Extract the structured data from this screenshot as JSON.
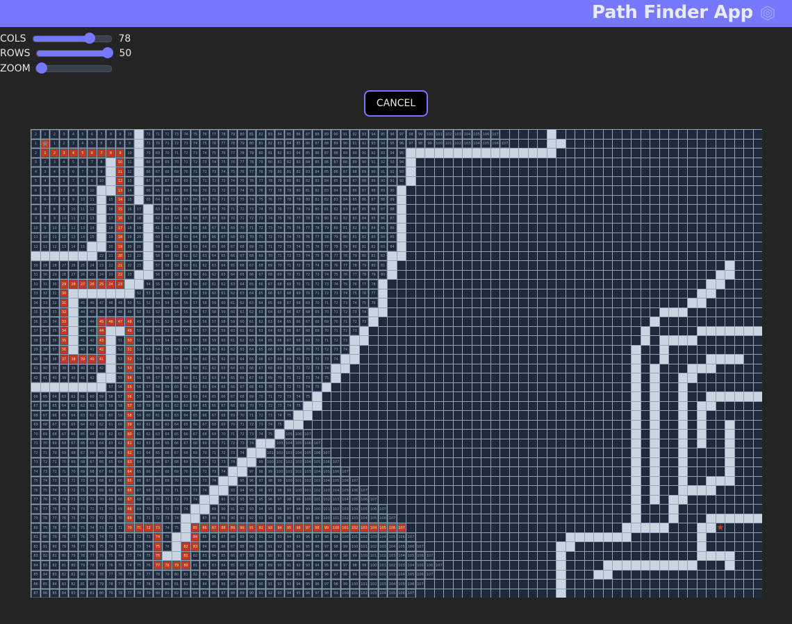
{
  "header": {
    "title": "Path Finder App",
    "logo_icon": "hexagon-target-icon"
  },
  "controls": [
    {
      "label": "COLS",
      "value": "78",
      "fraction": 0.72
    },
    {
      "label": "ROWS",
      "value": "50",
      "fraction": 1.0
    },
    {
      "label": "ZOOM",
      "value": "",
      "fraction": 0.0
    }
  ],
  "cancel_label": "CANCEL",
  "grid": {
    "cols": 78,
    "rows": 50,
    "start": [
      1,
      1
    ],
    "goal": [
      42,
      73
    ],
    "start_icon": "star-icon",
    "goal_icon": "star-icon",
    "max_distance_shown": 107,
    "colors": {
      "cell": "#1e293b",
      "wall": "#cbd5e1",
      "path": "#c0391f",
      "start_star": "#7b8594",
      "goal_star": "#c0391f"
    },
    "walls": [
      [
        0,
        11
      ],
      [
        0,
        55
      ],
      [
        1,
        11
      ],
      [
        1,
        55
      ],
      [
        1,
        56
      ],
      [
        2,
        11
      ],
      [
        2,
        40
      ],
      [
        2,
        41
      ],
      [
        2,
        42
      ],
      [
        2,
        43
      ],
      [
        2,
        44
      ],
      [
        2,
        45
      ],
      [
        2,
        46
      ],
      [
        2,
        47
      ],
      [
        2,
        48
      ],
      [
        2,
        49
      ],
      [
        2,
        50
      ],
      [
        2,
        51
      ],
      [
        2,
        52
      ],
      [
        2,
        53
      ],
      [
        2,
        54
      ],
      [
        2,
        55
      ],
      [
        3,
        8
      ],
      [
        3,
        11
      ],
      [
        3,
        40
      ],
      [
        4,
        8
      ],
      [
        4,
        11
      ],
      [
        4,
        40
      ],
      [
        5,
        8
      ],
      [
        5,
        11
      ],
      [
        5,
        40
      ],
      [
        6,
        7
      ],
      [
        6,
        8
      ],
      [
        6,
        11
      ],
      [
        6,
        39
      ],
      [
        7,
        7
      ],
      [
        7,
        11
      ],
      [
        7,
        39
      ],
      [
        8,
        7
      ],
      [
        8,
        12
      ],
      [
        8,
        39
      ],
      [
        9,
        7
      ],
      [
        9,
        12
      ],
      [
        9,
        39
      ],
      [
        10,
        7
      ],
      [
        10,
        12
      ],
      [
        10,
        39
      ],
      [
        11,
        7
      ],
      [
        11,
        12
      ],
      [
        11,
        39
      ],
      [
        12,
        6
      ],
      [
        12,
        7
      ],
      [
        12,
        12
      ],
      [
        12,
        39
      ],
      [
        13,
        0
      ],
      [
        13,
        1
      ],
      [
        13,
        2
      ],
      [
        13,
        3
      ],
      [
        13,
        4
      ],
      [
        13,
        5
      ],
      [
        13,
        6
      ],
      [
        13,
        12
      ],
      [
        13,
        38
      ],
      [
        13,
        39
      ],
      [
        14,
        12
      ],
      [
        14,
        38
      ],
      [
        14,
        74
      ],
      [
        15,
        11
      ],
      [
        15,
        12
      ],
      [
        15,
        38
      ],
      [
        15,
        73
      ],
      [
        15,
        74
      ],
      [
        16,
        10
      ],
      [
        16,
        11
      ],
      [
        16,
        37
      ],
      [
        16,
        72
      ],
      [
        16,
        73
      ],
      [
        17,
        4
      ],
      [
        17,
        5
      ],
      [
        17,
        6
      ],
      [
        17,
        7
      ],
      [
        17,
        8
      ],
      [
        17,
        9
      ],
      [
        17,
        10
      ],
      [
        17,
        37
      ],
      [
        17,
        71
      ],
      [
        17,
        72
      ],
      [
        18,
        4
      ],
      [
        18,
        37
      ],
      [
        18,
        70
      ],
      [
        18,
        71
      ],
      [
        19,
        4
      ],
      [
        19,
        36
      ],
      [
        19,
        37
      ],
      [
        19,
        67
      ],
      [
        19,
        68
      ],
      [
        19,
        69
      ],
      [
        20,
        4
      ],
      [
        20,
        36
      ],
      [
        20,
        66
      ],
      [
        21,
        4
      ],
      [
        21,
        8
      ],
      [
        21,
        9
      ],
      [
        21,
        35
      ],
      [
        21,
        65
      ],
      [
        21,
        71
      ],
      [
        21,
        72
      ],
      [
        21,
        73
      ],
      [
        21,
        74
      ],
      [
        21,
        75
      ],
      [
        21,
        76
      ],
      [
        21,
        77
      ],
      [
        22,
        4
      ],
      [
        22,
        8
      ],
      [
        22,
        34
      ],
      [
        22,
        35
      ],
      [
        22,
        65
      ],
      [
        22,
        67
      ],
      [
        22,
        68
      ],
      [
        22,
        69
      ],
      [
        22,
        70
      ],
      [
        23,
        4
      ],
      [
        23,
        8
      ],
      [
        23,
        34
      ],
      [
        23,
        64
      ],
      [
        23,
        67
      ],
      [
        24,
        8
      ],
      [
        24,
        33
      ],
      [
        24,
        34
      ],
      [
        24,
        64
      ],
      [
        24,
        67
      ],
      [
        24,
        72
      ],
      [
        24,
        73
      ],
      [
        24,
        74
      ],
      [
        24,
        75
      ],
      [
        25,
        8
      ],
      [
        25,
        32
      ],
      [
        25,
        33
      ],
      [
        25,
        64
      ],
      [
        25,
        66
      ],
      [
        25,
        70
      ],
      [
        25,
        71
      ],
      [
        25,
        72
      ],
      [
        26,
        7
      ],
      [
        26,
        8
      ],
      [
        26,
        32
      ],
      [
        26,
        64
      ],
      [
        26,
        66
      ],
      [
        26,
        69
      ],
      [
        26,
        70
      ],
      [
        27,
        0
      ],
      [
        27,
        1
      ],
      [
        27,
        2
      ],
      [
        27,
        3
      ],
      [
        27,
        4
      ],
      [
        27,
        5
      ],
      [
        27,
        6
      ],
      [
        27,
        7
      ],
      [
        27,
        31
      ],
      [
        27,
        64
      ],
      [
        27,
        66
      ],
      [
        27,
        69
      ],
      [
        28,
        30
      ],
      [
        28,
        64
      ],
      [
        28,
        66
      ],
      [
        28,
        69
      ],
      [
        28,
        72
      ],
      [
        28,
        73
      ],
      [
        28,
        74
      ],
      [
        28,
        75
      ],
      [
        28,
        76
      ],
      [
        28,
        77
      ],
      [
        29,
        29
      ],
      [
        29,
        30
      ],
      [
        29,
        64
      ],
      [
        29,
        66
      ],
      [
        29,
        69
      ],
      [
        29,
        71
      ],
      [
        29,
        72
      ],
      [
        30,
        28
      ],
      [
        30,
        29
      ],
      [
        30,
        64
      ],
      [
        30,
        66
      ],
      [
        30,
        69
      ],
      [
        30,
        71
      ],
      [
        31,
        27
      ],
      [
        31,
        28
      ],
      [
        31,
        64
      ],
      [
        31,
        66
      ],
      [
        31,
        69
      ],
      [
        31,
        71
      ],
      [
        31,
        74
      ],
      [
        32,
        26
      ],
      [
        32,
        64
      ],
      [
        32,
        66
      ],
      [
        32,
        69
      ],
      [
        32,
        71
      ],
      [
        32,
        74
      ],
      [
        33,
        24
      ],
      [
        33,
        25
      ],
      [
        33,
        64
      ],
      [
        33,
        66
      ],
      [
        33,
        69
      ],
      [
        33,
        71
      ],
      [
        33,
        74
      ],
      [
        34,
        23
      ],
      [
        34,
        24
      ],
      [
        34,
        64
      ],
      [
        34,
        66
      ],
      [
        34,
        69
      ],
      [
        34,
        74
      ],
      [
        35,
        22
      ],
      [
        35,
        23
      ],
      [
        35,
        64
      ],
      [
        35,
        66
      ],
      [
        35,
        69
      ],
      [
        35,
        74
      ],
      [
        36,
        21
      ],
      [
        36,
        22
      ],
      [
        36,
        64
      ],
      [
        36,
        66
      ],
      [
        36,
        69
      ],
      [
        36,
        74
      ],
      [
        37,
        20
      ],
      [
        37,
        21
      ],
      [
        37,
        64
      ],
      [
        37,
        66
      ],
      [
        37,
        69
      ],
      [
        37,
        72
      ],
      [
        37,
        73
      ],
      [
        37,
        74
      ],
      [
        38,
        19
      ],
      [
        38,
        20
      ],
      [
        38,
        64
      ],
      [
        38,
        66
      ],
      [
        38,
        69
      ],
      [
        38,
        70
      ],
      [
        38,
        71
      ],
      [
        38,
        72
      ],
      [
        39,
        18
      ],
      [
        39,
        19
      ],
      [
        39,
        64
      ],
      [
        39,
        66
      ],
      [
        39,
        68
      ],
      [
        39,
        69
      ],
      [
        40,
        17
      ],
      [
        40,
        18
      ],
      [
        40,
        64
      ],
      [
        40,
        68
      ],
      [
        41,
        16
      ],
      [
        41,
        17
      ],
      [
        41,
        64
      ],
      [
        41,
        68
      ],
      [
        41,
        72
      ],
      [
        41,
        73
      ],
      [
        41,
        74
      ],
      [
        41,
        75
      ],
      [
        41,
        76
      ],
      [
        41,
        77
      ],
      [
        42,
        16
      ],
      [
        42,
        63
      ],
      [
        42,
        64
      ],
      [
        42,
        65
      ],
      [
        42,
        66
      ],
      [
        42,
        67
      ],
      [
        42,
        71
      ],
      [
        42,
        72
      ],
      [
        43,
        15
      ],
      [
        43,
        16
      ],
      [
        43,
        57
      ],
      [
        43,
        58
      ],
      [
        43,
        59
      ],
      [
        43,
        60
      ],
      [
        43,
        61
      ],
      [
        43,
        62
      ],
      [
        43,
        63
      ],
      [
        43,
        71
      ],
      [
        44,
        15
      ],
      [
        44,
        56
      ],
      [
        44,
        57
      ],
      [
        44,
        71
      ],
      [
        45,
        14
      ],
      [
        45,
        15
      ],
      [
        45,
        56
      ],
      [
        45,
        71
      ],
      [
        45,
        72
      ],
      [
        45,
        73
      ],
      [
        45,
        74
      ],
      [
        46,
        56
      ],
      [
        46,
        61
      ],
      [
        46,
        62
      ],
      [
        46,
        63
      ],
      [
        46,
        64
      ],
      [
        46,
        65
      ],
      [
        46,
        66
      ],
      [
        46,
        67
      ],
      [
        46,
        68
      ],
      [
        46,
        69
      ],
      [
        46,
        70
      ],
      [
        46,
        74
      ],
      [
        47,
        56
      ],
      [
        47,
        60
      ],
      [
        47,
        61
      ],
      [
        48,
        56
      ],
      [
        49,
        56
      ]
    ],
    "path": [
      [
        2,
        1
      ],
      [
        2,
        2
      ],
      [
        2,
        3
      ],
      [
        2,
        4
      ],
      [
        2,
        5
      ],
      [
        2,
        6
      ],
      [
        2,
        7
      ],
      [
        2,
        8
      ],
      [
        2,
        9
      ],
      [
        3,
        9
      ],
      [
        4,
        9
      ],
      [
        5,
        9
      ],
      [
        6,
        9
      ],
      [
        7,
        9
      ],
      [
        8,
        9
      ],
      [
        9,
        9
      ],
      [
        10,
        9
      ],
      [
        11,
        9
      ],
      [
        12,
        9
      ],
      [
        13,
        9
      ],
      [
        14,
        9
      ],
      [
        15,
        9
      ],
      [
        16,
        9
      ],
      [
        16,
        8
      ],
      [
        16,
        7
      ],
      [
        16,
        6
      ],
      [
        16,
        5
      ],
      [
        16,
        4
      ],
      [
        16,
        3
      ],
      [
        17,
        3
      ],
      [
        18,
        3
      ],
      [
        19,
        3
      ],
      [
        20,
        3
      ],
      [
        21,
        3
      ],
      [
        22,
        3
      ],
      [
        23,
        3
      ],
      [
        24,
        3
      ],
      [
        24,
        4
      ],
      [
        24,
        5
      ],
      [
        24,
        6
      ],
      [
        24,
        7
      ],
      [
        23,
        7
      ],
      [
        22,
        7
      ],
      [
        21,
        7
      ],
      [
        20,
        7
      ],
      [
        20,
        8
      ],
      [
        20,
        9
      ],
      [
        20,
        10
      ],
      [
        21,
        10
      ],
      [
        22,
        10
      ],
      [
        23,
        10
      ],
      [
        24,
        10
      ],
      [
        25,
        10
      ],
      [
        26,
        10
      ],
      [
        27,
        10
      ],
      [
        28,
        10
      ],
      [
        29,
        10
      ],
      [
        30,
        10
      ],
      [
        31,
        10
      ],
      [
        32,
        10
      ],
      [
        33,
        10
      ],
      [
        34,
        10
      ],
      [
        35,
        10
      ],
      [
        36,
        10
      ],
      [
        37,
        10
      ],
      [
        38,
        10
      ],
      [
        39,
        10
      ],
      [
        40,
        10
      ],
      [
        41,
        10
      ],
      [
        42,
        10
      ],
      [
        42,
        11
      ],
      [
        42,
        12
      ],
      [
        42,
        13
      ],
      [
        43,
        13
      ],
      [
        44,
        13
      ],
      [
        45,
        13
      ],
      [
        46,
        13
      ],
      [
        46,
        14
      ],
      [
        46,
        15
      ],
      [
        46,
        16
      ],
      [
        45,
        16
      ],
      [
        44,
        16
      ],
      [
        44,
        17
      ],
      [
        43,
        17
      ],
      [
        42,
        17
      ],
      [
        42,
        18
      ],
      [
        42,
        19
      ],
      [
        42,
        20
      ],
      [
        42,
        21
      ],
      [
        42,
        22
      ],
      [
        42,
        23
      ],
      [
        42,
        24
      ],
      [
        42,
        25
      ],
      [
        42,
        26
      ],
      [
        42,
        27
      ],
      [
        42,
        28
      ],
      [
        42,
        29
      ],
      [
        42,
        30
      ],
      [
        42,
        31
      ],
      [
        42,
        32
      ],
      [
        42,
        33
      ],
      [
        42,
        34
      ],
      [
        42,
        35
      ],
      [
        42,
        36
      ],
      [
        42,
        37
      ],
      [
        42,
        38
      ],
      [
        42,
        39
      ]
    ]
  }
}
